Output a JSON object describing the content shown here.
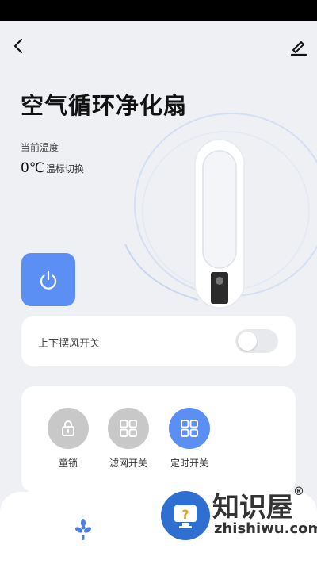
{
  "header": {
    "back_icon": "chevron-left-icon",
    "edit_icon": "pencil-icon"
  },
  "device": {
    "title": "空气循环净化扇",
    "temp_label": "当前温度",
    "temp_value": "0℃",
    "temp_switch": "温标切换"
  },
  "power": {
    "icon": "power-icon",
    "color": "#5b8ff3"
  },
  "swing": {
    "label": "上下摆风开关",
    "on": false
  },
  "functions": [
    {
      "label": "童锁",
      "icon": "lock-icon",
      "active": false
    },
    {
      "label": "滤网开关",
      "icon": "grid-icon",
      "active": false
    },
    {
      "label": "定时开关",
      "icon": "grid-icon",
      "active": true
    }
  ],
  "colors": {
    "accent": "#5b8ff3",
    "inactive": "#c8c8c8",
    "background": "#eef0f4"
  },
  "bottom_tab": {
    "icon": "fan-icon"
  },
  "watermark": {
    "text": "知识屋",
    "reg": "®",
    "url": "zhishiwu.com"
  }
}
